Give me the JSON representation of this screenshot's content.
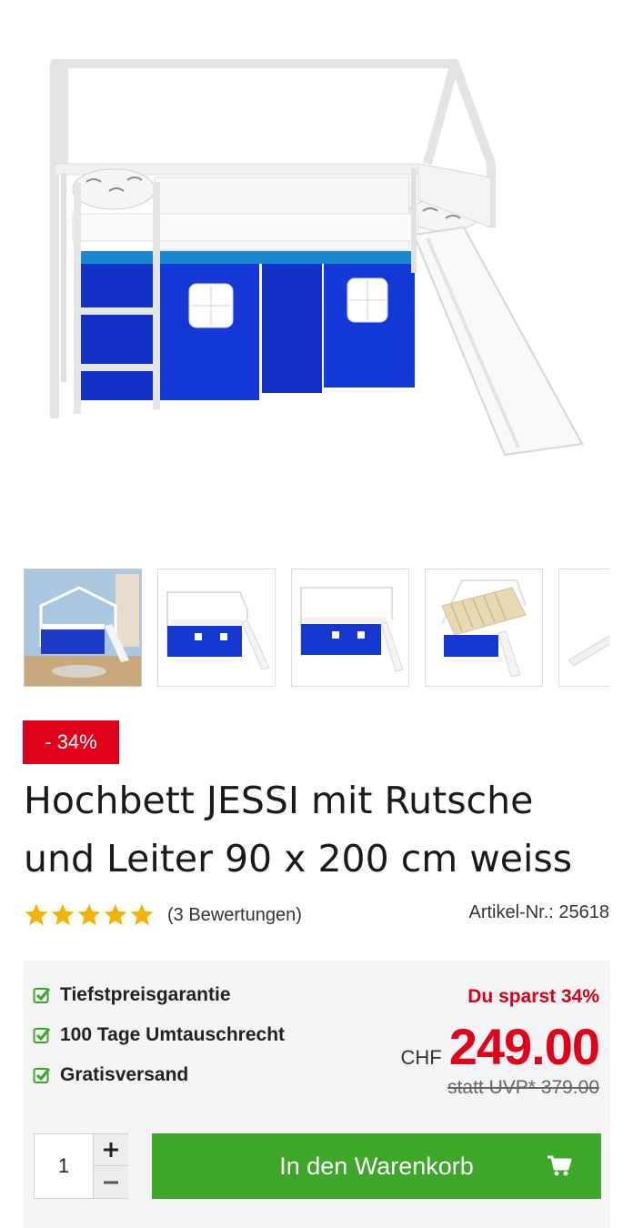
{
  "product": {
    "discount_badge": "- 34%",
    "title": "Hochbett JESSI mit Rutsche und Leiter 90 x 200 cm weiss",
    "rating_stars": 5,
    "reviews_text": "(3 Bewertungen)",
    "sku_text": "Artikel-Nr.: 25618"
  },
  "gallery": {
    "main_image_icon": "loft-bed-image",
    "thumbnails": [
      "room-scene",
      "front-view",
      "front-view-2",
      "top-view",
      "slide-detail"
    ]
  },
  "buybox": {
    "benefits": [
      "Tiefstpreisgarantie",
      "100 Tage Umtauschrecht",
      "Gratisversand"
    ],
    "savings_text": "Du sparst 34%",
    "currency": "CHF",
    "price": "249.00",
    "old_price": "statt UVP* 379.00",
    "quantity": "1",
    "cart_label": "In den Warenkorb"
  },
  "colors": {
    "accent_red": "#e1001a",
    "cart_green": "#3ea629",
    "check_green": "#3ea629",
    "star_gold": "#f5b301"
  }
}
